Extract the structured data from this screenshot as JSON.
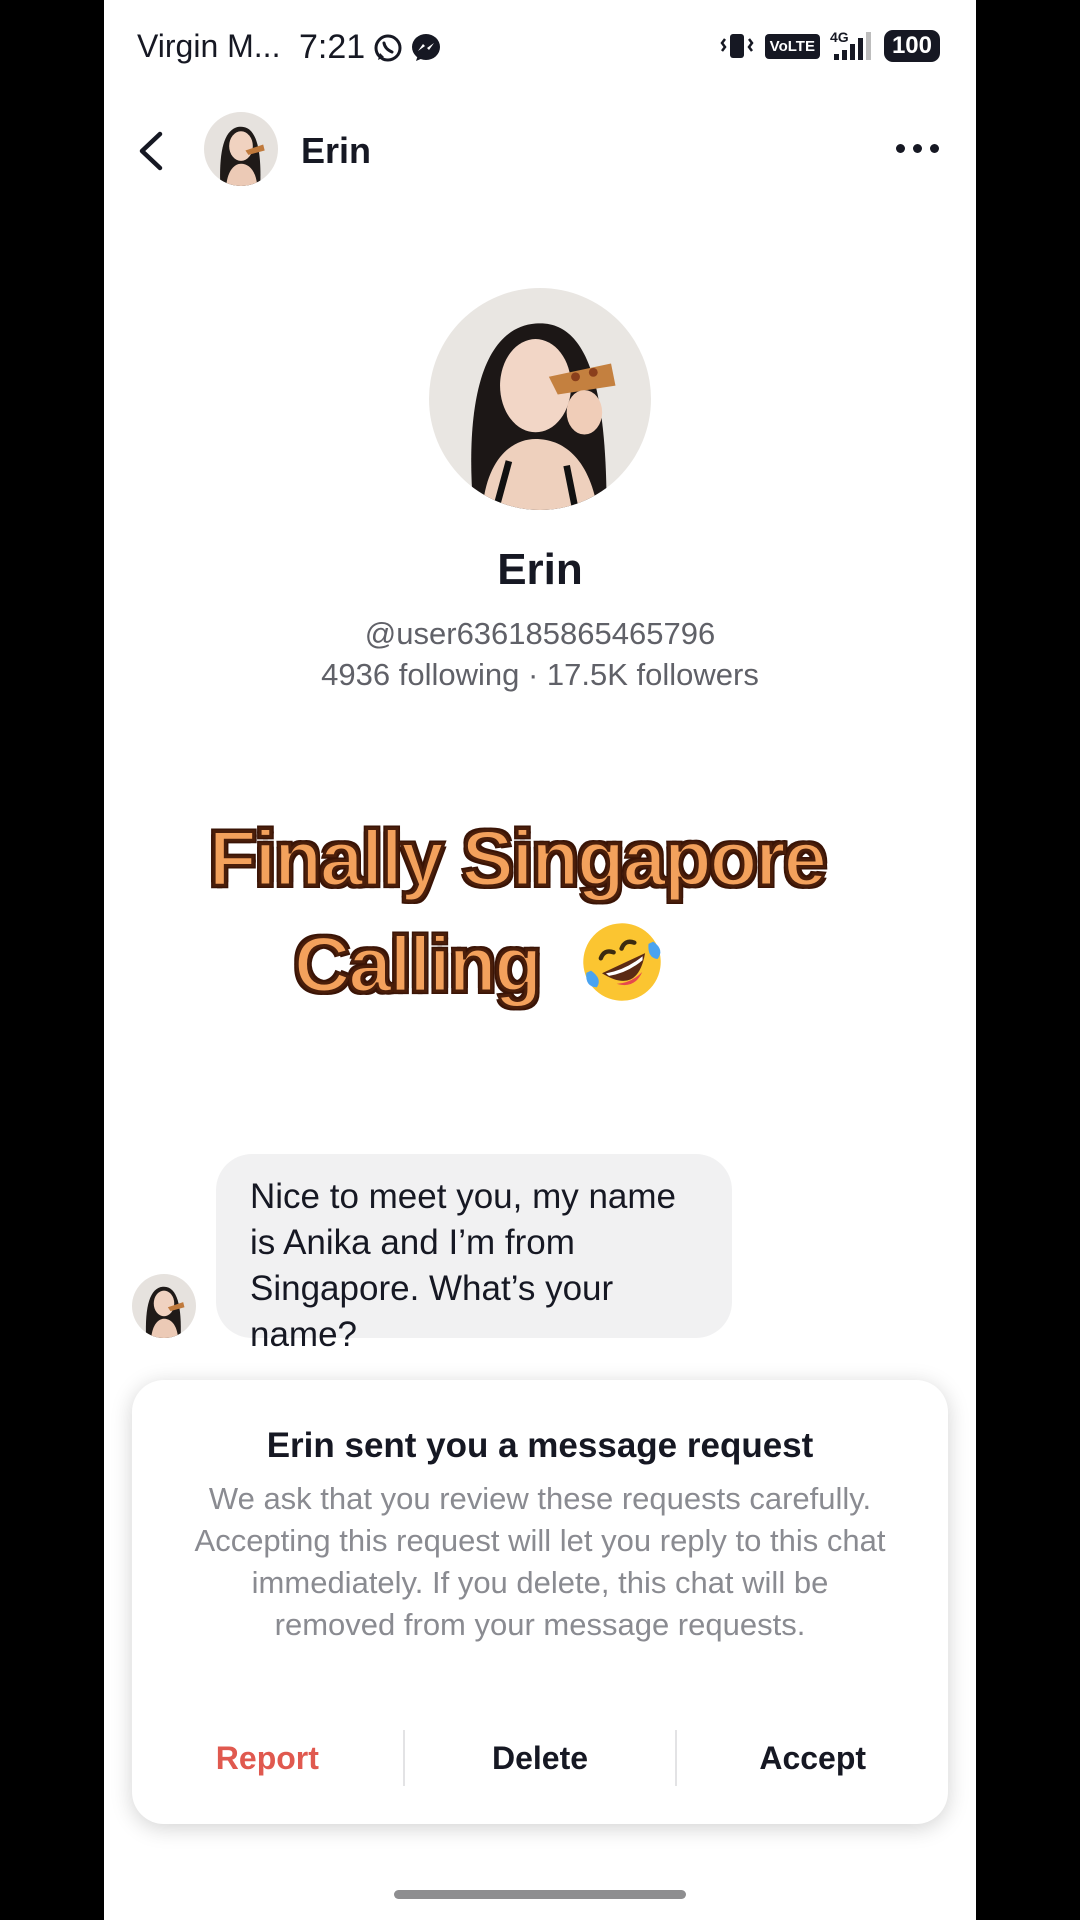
{
  "status_bar": {
    "carrier": "Virgin M...",
    "time": "7:21",
    "network_badge": "VoLTE",
    "signal_label": "4G",
    "battery": "100",
    "icons": [
      "whatsapp-icon",
      "messenger-icon",
      "vibrate-icon",
      "signal-icon"
    ]
  },
  "header": {
    "contact_name": "Erin",
    "icons": [
      "back-arrow-icon",
      "avatar",
      "more-options-icon"
    ]
  },
  "profile": {
    "name": "Erin",
    "handle": "@user636185865465796",
    "stats": "4936 following · 17.5K followers"
  },
  "overlay_caption": {
    "line1": "Finally Singapore",
    "line2": "Calling",
    "emoji": "rolling-on-floor-laughing-emoji"
  },
  "message": {
    "text": "Nice to meet you, my name is Anika and I’m from Singapore. What’s your name?"
  },
  "request_card": {
    "title": "Erin sent you a message request",
    "body": "We ask that you review these requests carefully. Accepting this request will let you reply to this chat immediately. If you delete, this chat will be removed from your message requests.",
    "report_label": "Report",
    "delete_label": "Delete",
    "accept_label": "Accept"
  },
  "colors": {
    "report": "#e0594f",
    "caption_fill": "#f3a15c",
    "caption_outline": "#4a1e0a",
    "bubble_bg": "#f1f1f2"
  }
}
